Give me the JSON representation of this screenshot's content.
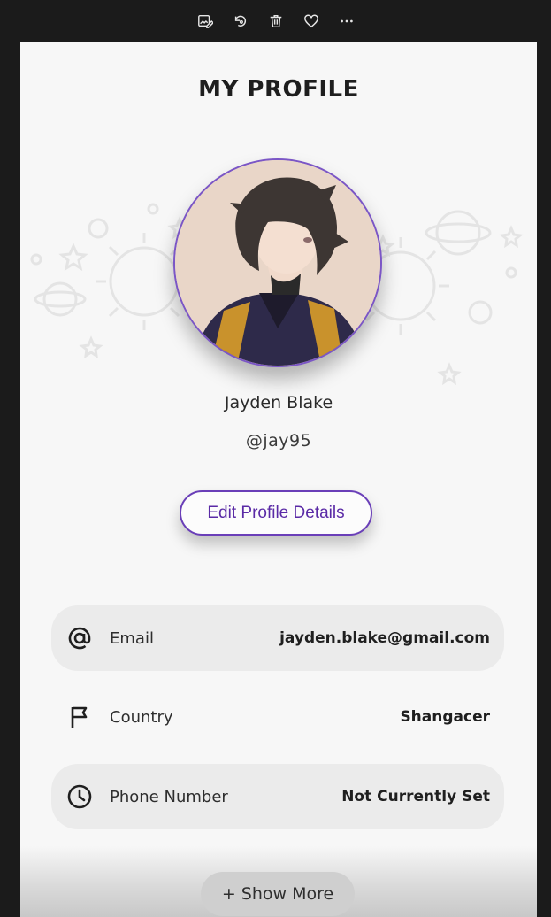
{
  "toolbar": {
    "icons": [
      "edit-image-icon",
      "rotate-icon",
      "trash-icon",
      "heart-icon",
      "more-icon"
    ]
  },
  "profile": {
    "page_title": "MY PROFILE",
    "display_name": "Jayden Blake",
    "handle": "@jay95",
    "edit_button_label": "Edit Profile Details"
  },
  "details": {
    "email": {
      "label": "Email",
      "value": "jayden.blake@gmail.com",
      "icon": "at-sign-icon"
    },
    "country": {
      "label": "Country",
      "value": "Shangacer",
      "icon": "flag-icon"
    },
    "phone": {
      "label": "Phone Number",
      "value": "Not Currently Set",
      "icon": "clock-icon"
    }
  },
  "show_more_label": "+ Show More",
  "colors": {
    "accent": "#6a3fb8",
    "background": "#f7f7f7",
    "row_shade": "#ebebeb"
  }
}
